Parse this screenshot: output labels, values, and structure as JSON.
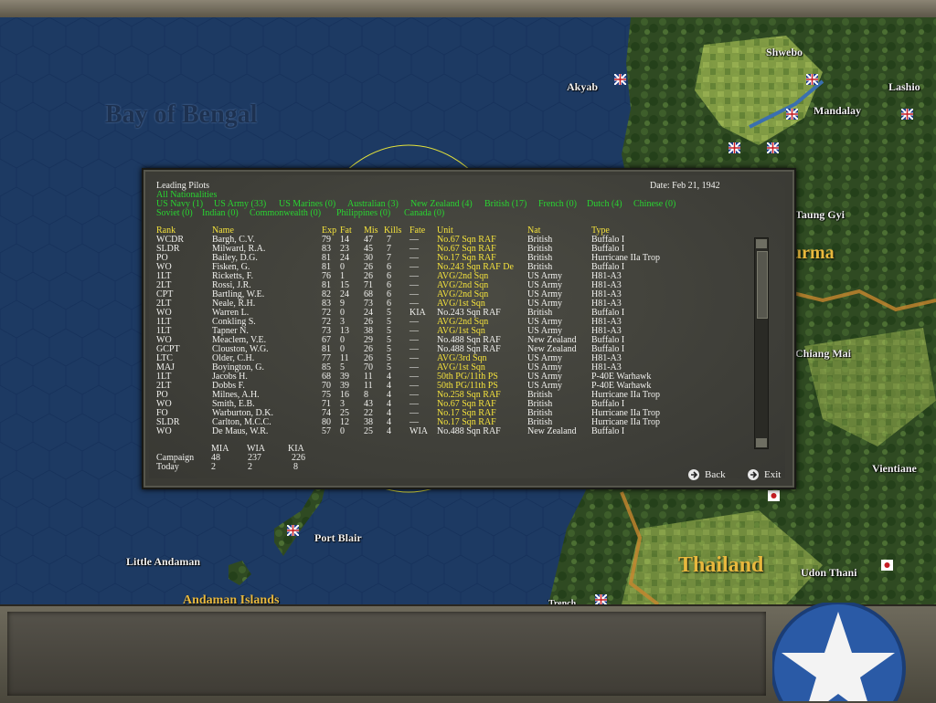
{
  "map": {
    "labels": {
      "bay_of_bengal": "Bay of Bengal",
      "akyab": "Akyab",
      "shwebo": "Shwebo",
      "lashio": "Lashio",
      "mandalay": "Mandalay",
      "taung_gyi": "Taung Gyi",
      "burma": "urma",
      "chiang_mai": "Chiang Mai",
      "vientiane": "Vientiane",
      "port_blair": "Port Blair",
      "little_andaman": "Little Andaman",
      "andaman_islands": "Andaman Islands",
      "thailand": "Thailand",
      "udon_thani": "Udon Thani",
      "fragment": "Trench"
    }
  },
  "dialog": {
    "title": "Leading Pilots",
    "date": "Date: Feb 21, 1942",
    "filters_row1": [
      "All Nationalities"
    ],
    "filters_row2": [
      "US Navy (1)",
      "US Army (33)",
      "US Marines (0)",
      "Australian (3)",
      "New Zealand (4)",
      "British (17)",
      "French (0)",
      "Dutch (4)",
      "Chinese (0)"
    ],
    "filters_row3": [
      "Soviet (0)",
      "Indian (0)",
      "Commonwealth (0)",
      "Philippines (0)",
      "Canada (0)"
    ],
    "columns": [
      "Rank",
      "Name",
      "Exp",
      "Fat",
      "Mis",
      "Kills",
      "Fate",
      "Unit",
      "Nat",
      "Type"
    ],
    "rows": [
      [
        "WCDR",
        "Bargh, C.V.",
        "79",
        "14",
        "47",
        "7",
        "—",
        "No.67 Sqn RAF",
        "British",
        "Buffalo I"
      ],
      [
        "SLDR",
        "Milward, R.A.",
        "83",
        "23",
        "45",
        "7",
        "—",
        "No.67 Sqn RAF",
        "British",
        "Buffalo I"
      ],
      [
        "PO",
        "Bailey, D.G.",
        "81",
        "24",
        "30",
        "7",
        "—",
        "No.17 Sqn RAF",
        "British",
        "Hurricane IIa Trop"
      ],
      [
        "WO",
        "Fisken, G.",
        "81",
        "0",
        "26",
        "6",
        "—",
        "No.243 Sqn RAF De",
        "British",
        "Buffalo I"
      ],
      [
        "1LT",
        "Ricketts, F.",
        "76",
        "1",
        "26",
        "6",
        "—",
        "AVG/2nd Sqn",
        "US Army",
        "H81-A3"
      ],
      [
        "2LT",
        "Rossi, J.R.",
        "81",
        "15",
        "71",
        "6",
        "—",
        "AVG/2nd Sqn",
        "US Army",
        "H81-A3"
      ],
      [
        "CPT",
        "Bartling, W.E.",
        "82",
        "24",
        "68",
        "6",
        "—",
        "AVG/2nd Sqn",
        "US Army",
        "H81-A3"
      ],
      [
        "2LT",
        "Neale, R.H.",
        "83",
        "9",
        "73",
        "6",
        "—",
        "AVG/1st Sqn",
        "US Army",
        "H81-A3"
      ],
      [
        "WO",
        "Warren L.",
        "72",
        "0",
        "24",
        "5",
        "KIA",
        "No.243 Sqn RAF",
        "British",
        "Buffalo I"
      ],
      [
        "1LT",
        "Conkling S.",
        "72",
        "3",
        "26",
        "5",
        "—",
        "AVG/2nd Sqn",
        "US Army",
        "H81-A3"
      ],
      [
        "1LT",
        "Tapner N.",
        "73",
        "13",
        "38",
        "5",
        "—",
        "AVG/1st Sqn",
        "US Army",
        "H81-A3"
      ],
      [
        "WO",
        "Meaclem, V.E.",
        "67",
        "0",
        "29",
        "5",
        "—",
        "No.488 Sqn RAF",
        "New Zealand",
        "Buffalo I"
      ],
      [
        "GCPT",
        "Clouston, W.G.",
        "81",
        "0",
        "26",
        "5",
        "—",
        "No.488 Sqn RAF",
        "New Zealand",
        "Buffalo I"
      ],
      [
        "LTC",
        "Older, C.H.",
        "77",
        "11",
        "26",
        "5",
        "—",
        "AVG/3rd Sqn",
        "US Army",
        "H81-A3"
      ],
      [
        "MAJ",
        "Boyington, G.",
        "85",
        "5",
        "70",
        "5",
        "—",
        "AVG/1st Sqn",
        "US Army",
        "H81-A3"
      ],
      [
        "1LT",
        "Jacobs H.",
        "68",
        "39",
        "11",
        "4",
        "—",
        "50th PG/11th PS",
        "US Army",
        "P-40E Warhawk"
      ],
      [
        "2LT",
        "Dobbs F.",
        "70",
        "39",
        "11",
        "4",
        "—",
        "50th PG/11th PS",
        "US Army",
        "P-40E Warhawk"
      ],
      [
        "PO",
        "Milnes, A.H.",
        "75",
        "16",
        "8",
        "4",
        "—",
        "No.258 Sqn RAF",
        "British",
        "Hurricane IIa Trop"
      ],
      [
        "WO",
        "Smith, E.B.",
        "71",
        "3",
        "43",
        "4",
        "—",
        "No.67 Sqn RAF",
        "British",
        "Buffalo I"
      ],
      [
        "FO",
        "Warburton, D.K.",
        "74",
        "25",
        "22",
        "4",
        "—",
        "No.17 Sqn RAF",
        "British",
        "Hurricane IIa Trop"
      ],
      [
        "SLDR",
        "Carlton, M.C.C.",
        "80",
        "12",
        "38",
        "4",
        "—",
        "No.17 Sqn RAF",
        "British",
        "Hurricane IIa Trop"
      ],
      [
        "WO",
        "De Maus, W.R.",
        "57",
        "0",
        "25",
        "4",
        "WIA",
        "No.488 Sqn RAF",
        "New Zealand",
        "Buffalo I"
      ]
    ],
    "unit_yellow": [
      true,
      true,
      true,
      true,
      true,
      true,
      true,
      true,
      false,
      true,
      true,
      false,
      false,
      true,
      true,
      true,
      true,
      true,
      true,
      true,
      true,
      false
    ],
    "summary": {
      "headers": [
        "MIA",
        "WIA",
        "KIA"
      ],
      "campaign_label": "Campaign",
      "campaign": [
        "48",
        "237",
        "226"
      ],
      "today_label": "Today",
      "today": [
        "2",
        "2",
        "8"
      ]
    },
    "back_label": "Back",
    "exit_label": "Exit"
  },
  "colors": {
    "sea": "#1d3a63",
    "land": "#2e4a1e",
    "label_gold": "#e8b83d",
    "filter_green": "#29d431",
    "unit_yellow": "#f4e23c"
  }
}
